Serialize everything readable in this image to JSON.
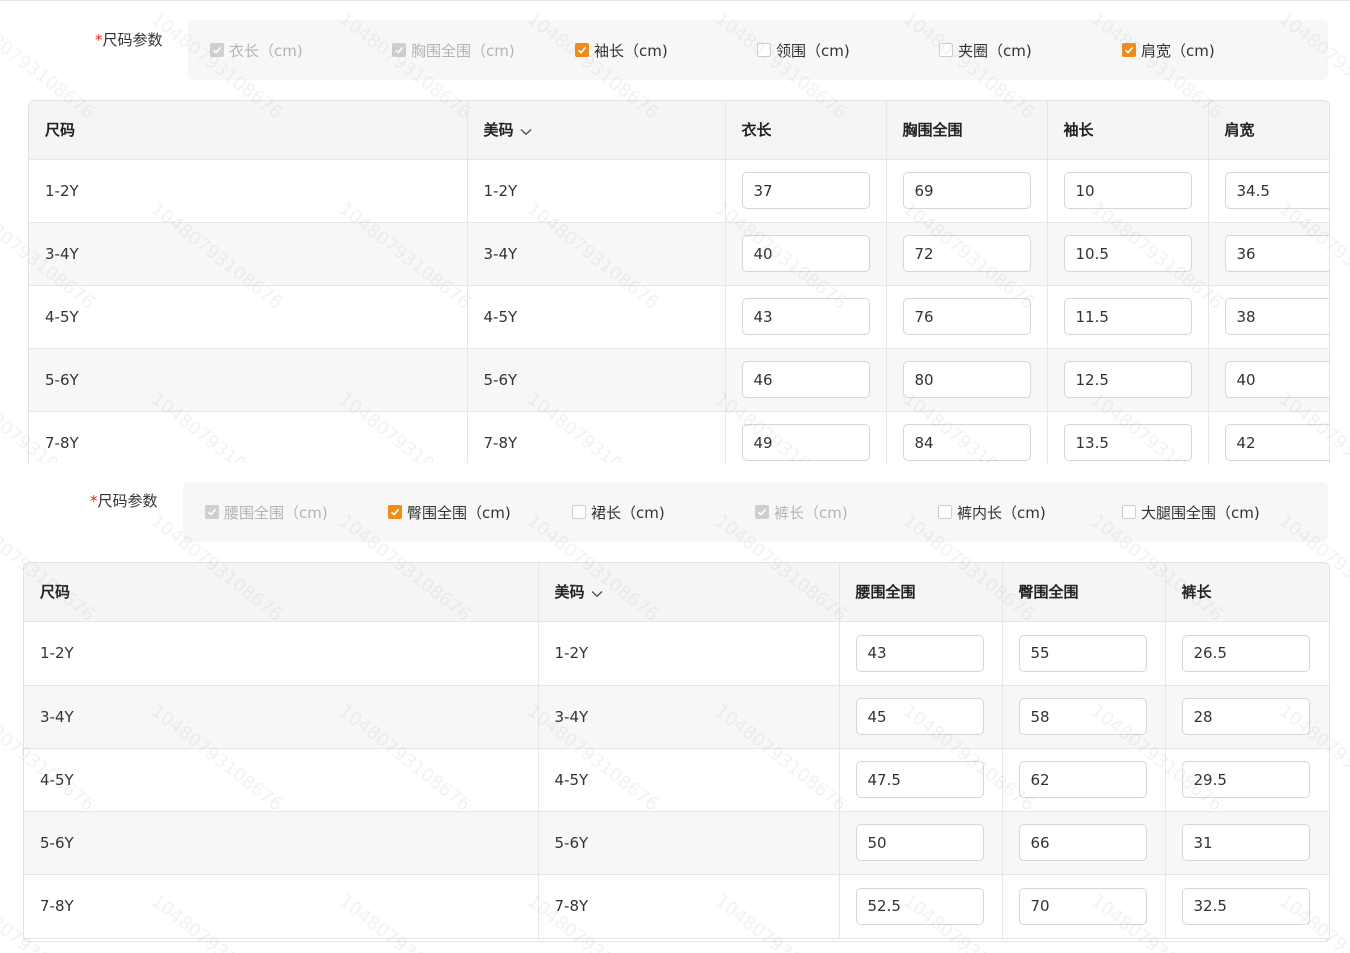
{
  "top": {
    "param_label": "尺码参数",
    "required_mark": "*",
    "options": [
      {
        "label": "衣长（cm)",
        "state": "checked-disabled"
      },
      {
        "label": "胸围全围（cm)",
        "state": "checked-disabled"
      },
      {
        "label": "袖长（cm)",
        "state": "checked"
      },
      {
        "label": "领围（cm)",
        "state": "unchecked"
      },
      {
        "label": "夹圈（cm)",
        "state": "unchecked"
      },
      {
        "label": "肩宽（cm)",
        "state": "checked"
      }
    ],
    "columns": [
      "尺码",
      "美码",
      "衣长",
      "胸围全围",
      "袖长",
      "肩宽"
    ],
    "rows": [
      {
        "size": "1-2Y",
        "us": "1-2Y",
        "values": [
          "37",
          "69",
          "10",
          "34.5"
        ]
      },
      {
        "size": "3-4Y",
        "us": "3-4Y",
        "values": [
          "40",
          "72",
          "10.5",
          "36"
        ]
      },
      {
        "size": "4-5Y",
        "us": "4-5Y",
        "values": [
          "43",
          "76",
          "11.5",
          "38"
        ]
      },
      {
        "size": "5-6Y",
        "us": "5-6Y",
        "values": [
          "46",
          "80",
          "12.5",
          "40"
        ]
      },
      {
        "size": "7-8Y",
        "us": "7-8Y",
        "values": [
          "49",
          "84",
          "13.5",
          "42"
        ]
      }
    ]
  },
  "bottom": {
    "param_label": "尺码参数",
    "required_mark": "*",
    "options": [
      {
        "label": "腰围全围（cm)",
        "state": "checked-disabled"
      },
      {
        "label": "臀围全围（cm)",
        "state": "checked"
      },
      {
        "label": "裙长（cm)",
        "state": "unchecked"
      },
      {
        "label": "裤长（cm)",
        "state": "checked-disabled"
      },
      {
        "label": "裤内长（cm)",
        "state": "unchecked"
      },
      {
        "label": "大腿围全围（cm)",
        "state": "unchecked"
      }
    ],
    "columns": [
      "尺码",
      "美码",
      "腰围全围",
      "臀围全围",
      "裤长"
    ],
    "rows": [
      {
        "size": "1-2Y",
        "us": "1-2Y",
        "values": [
          "43",
          "55",
          "26.5"
        ]
      },
      {
        "size": "3-4Y",
        "us": "3-4Y",
        "values": [
          "45",
          "58",
          "28"
        ]
      },
      {
        "size": "4-5Y",
        "us": "4-5Y",
        "values": [
          "47.5",
          "62",
          "29.5"
        ]
      },
      {
        "size": "5-6Y",
        "us": "5-6Y",
        "values": [
          "50",
          "66",
          "31"
        ]
      },
      {
        "size": "7-8Y",
        "us": "7-8Y",
        "values": [
          "52.5",
          "70",
          "32.5"
        ]
      }
    ]
  },
  "watermark_text": "10480793108676",
  "colors": {
    "accent": "#f08c1a",
    "required": "#e3241b",
    "header_bg": "#f5f5f5",
    "alt_row_bg": "#f7f7f7"
  },
  "icons": {
    "us_size_sort": "chevron-down-icon",
    "check": "check-icon"
  }
}
